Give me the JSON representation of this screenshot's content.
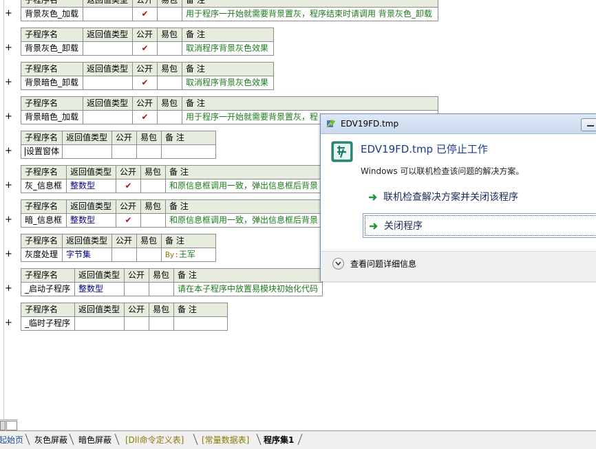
{
  "table_headers": {
    "name": "子程序名",
    "return_type": "返回值类型",
    "public": "公开",
    "easy_pack": "易包",
    "remark": "备 注"
  },
  "subprograms": [
    {
      "name": "背景灰色_加载",
      "return_type": "",
      "public": "✔",
      "easy_pack": "",
      "remark": "用于程序一开始就需要背景置灰，程序结束时请调用 背景灰色_卸载"
    },
    {
      "name": "背景灰色_卸载",
      "return_type": "",
      "public": "✔",
      "easy_pack": "",
      "remark": "取消程序背景灰色效果"
    },
    {
      "name": "背景暗色_卸载",
      "return_type": "",
      "public": "✔",
      "easy_pack": "",
      "remark": "取消程序背景灰色效果"
    },
    {
      "name": "背景暗色_加载",
      "return_type": "",
      "public": "✔",
      "easy_pack": "",
      "remark": "用于程序一开始就需要背景置灰，程"
    },
    {
      "name": "设置窗体",
      "return_type": "",
      "public": "",
      "easy_pack": "",
      "remark": ""
    },
    {
      "name": "灰_信息框",
      "return_type": "整数型",
      "public": "✔",
      "easy_pack": "",
      "remark": "和原信息框调用一致，弹出信息框后背景"
    },
    {
      "name": "暗_信息框",
      "return_type": "整数型",
      "public": "✔",
      "easy_pack": "",
      "remark": "和原信息框调用一致，弹出信息框后背景"
    },
    {
      "name": "灰度处理",
      "return_type": "字节集",
      "public": "",
      "easy_pack": "",
      "remark_prefix": "By:",
      "remark": "王军"
    },
    {
      "name": "_启动子程序",
      "return_type": "整数型",
      "public": "",
      "easy_pack": "",
      "remark": "请在本子程序中放置易模块初始化代码"
    },
    {
      "name": "_临时子程序",
      "return_type": "",
      "public": "",
      "easy_pack": "",
      "remark": ""
    }
  ],
  "plus_symbol": "+",
  "dialog": {
    "title": "EDV19FD.tmp",
    "heading": "EDV19FD.tmp 已停止工作",
    "message": "Windows 可以联机检查该问题的解决方案。",
    "option_check": "联机检查解决方案并关闭该程序",
    "option_close": "关闭程序",
    "details": "查看问题详细信息"
  },
  "tabs": [
    {
      "label": "起始页"
    },
    {
      "label": "灰色屏蔽"
    },
    {
      "label": "暗色屏蔽"
    },
    {
      "label": "[Dll命令定义表]"
    },
    {
      "label": "[常量数据表]"
    },
    {
      "label": "程序集1"
    }
  ],
  "colors": {
    "header_bg": "#e6eddf",
    "remark_green": "#1c7a1c",
    "type_navy": "#000080",
    "check_red": "#b01414",
    "dialog_heading": "#1e3a8c"
  }
}
